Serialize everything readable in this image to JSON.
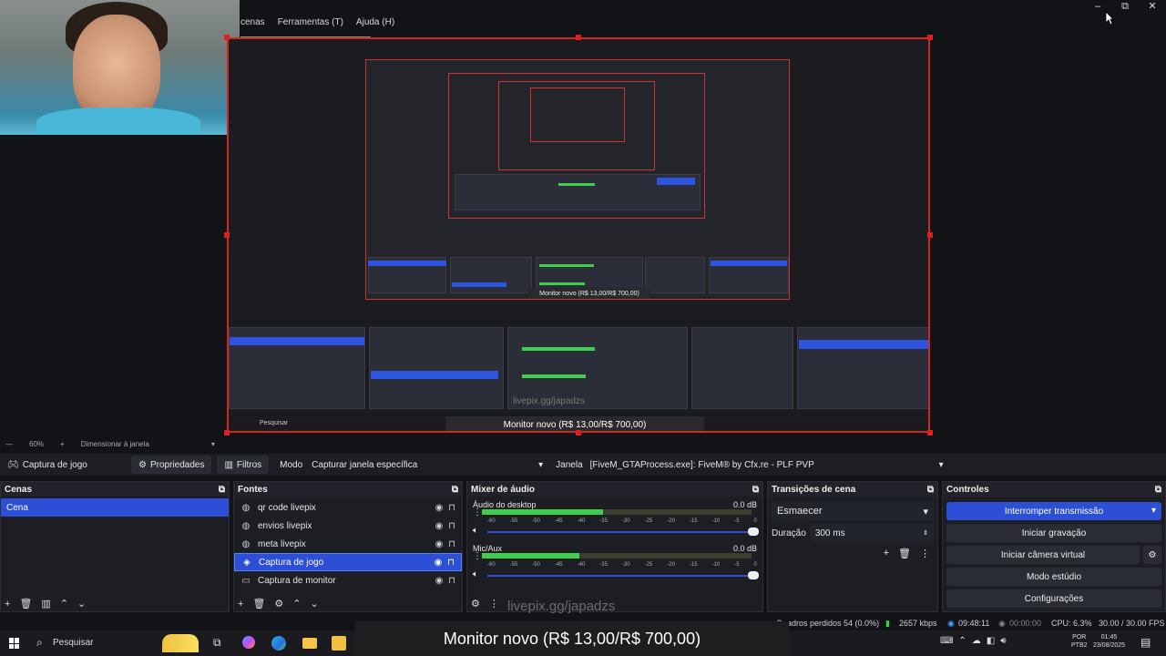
{
  "menu": {
    "items": [
      "cenas",
      "Ferramentas (T)",
      "Ajuda (H)"
    ]
  },
  "window_controls": {
    "minimize": "–",
    "restore": "⧉",
    "close": "✕"
  },
  "preview": {
    "inner_banner": "Monitor novo (R$ 13,00/R$ 700,00)",
    "inner_watermark": "livepix.gg/japadzs",
    "inner_search": "Pesquisar"
  },
  "zoom": {
    "level": "60%",
    "resize_label": "Dimensionar à janela"
  },
  "toolbar": {
    "source_name": "Captura de jogo",
    "properties": "Propriedades",
    "filters": "Filtros",
    "mode_label": "Modo",
    "mode_value": "Capturar janela específica",
    "window_label": "Janela",
    "window_value": "[FiveM_GTAProcess.exe]: FiveM® by Cfx.re - PLF PVP"
  },
  "scenes": {
    "title": "Cenas",
    "items": [
      {
        "label": "Cena",
        "selected": true
      }
    ]
  },
  "sources": {
    "title": "Fontes",
    "items": [
      {
        "label": "qr code livepix",
        "selected": false,
        "icon": "globe"
      },
      {
        "label": "envios livepix",
        "selected": false,
        "icon": "globe"
      },
      {
        "label": "meta livepix",
        "selected": false,
        "icon": "globe"
      },
      {
        "label": "Captura de jogo",
        "selected": true,
        "icon": "gamepad"
      },
      {
        "label": "Captura de monitor",
        "selected": false,
        "icon": "monitor"
      }
    ]
  },
  "mixer": {
    "title": "Mixer de áudio",
    "ticks": [
      "-60",
      "-55",
      "-50",
      "-45",
      "-40",
      "-35",
      "-30",
      "-25",
      "-20",
      "-15",
      "-10",
      "-5",
      "0"
    ],
    "channels": [
      {
        "name": "Áudio do desktop",
        "db": "0.0 dB",
        "level": 0.45
      },
      {
        "name": "Mic/Aux",
        "db": "0.0 dB",
        "level": 0.36
      }
    ]
  },
  "transitions": {
    "title": "Transições de cena",
    "type": "Esmaecer",
    "duration_label": "Duração",
    "duration_value": "300 ms"
  },
  "controls": {
    "title": "Controles",
    "stop_stream": "Interromper transmissão",
    "start_recording": "Iniciar gravação",
    "start_virtual_cam": "Iniciar câmera virtual",
    "studio_mode": "Modo estúdio",
    "settings": "Configurações"
  },
  "status": {
    "dropped_frames": "Quadros perdidos 54 (0.0%)",
    "bitrate": "2657 kbps",
    "live_time": "09:48:11",
    "rec_time": "00:00:00",
    "cpu": "CPU: 6.3%",
    "fps": "30.00 / 30.00 FPS"
  },
  "overlay": {
    "watermark": "livepix.gg/japadzs",
    "banner": "Monitor novo (R$ 13,00/R$ 700,00)"
  },
  "taskbar": {
    "search": "Pesquisar",
    "lang1": "POR",
    "lang2": "PTB2",
    "time": "01:45",
    "date": "23/08/2025"
  },
  "colors": {
    "accent": "#2d4fd6",
    "meter_green": "#3fcf4f",
    "selection_red": "#d42525"
  }
}
